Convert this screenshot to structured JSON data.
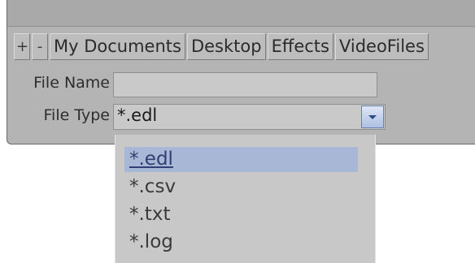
{
  "tabs": {
    "add_label": "+",
    "remove_label": "-",
    "items": [
      "My Documents",
      "Desktop",
      "Effects",
      "VideoFiles"
    ]
  },
  "form": {
    "file_name_label": "File Name",
    "file_name_value": "",
    "file_type_label": "File Type",
    "file_type_value": "*.edl"
  },
  "dropdown": {
    "options": [
      "*.edl",
      "*.csv",
      "*.txt",
      "*.log"
    ],
    "selected_index": 0
  },
  "colors": {
    "panel_bg": "#b4b4b4",
    "highlight": "#a9b7d6"
  },
  "icons": {
    "dropdown_toggle": "chevron-down-icon"
  }
}
